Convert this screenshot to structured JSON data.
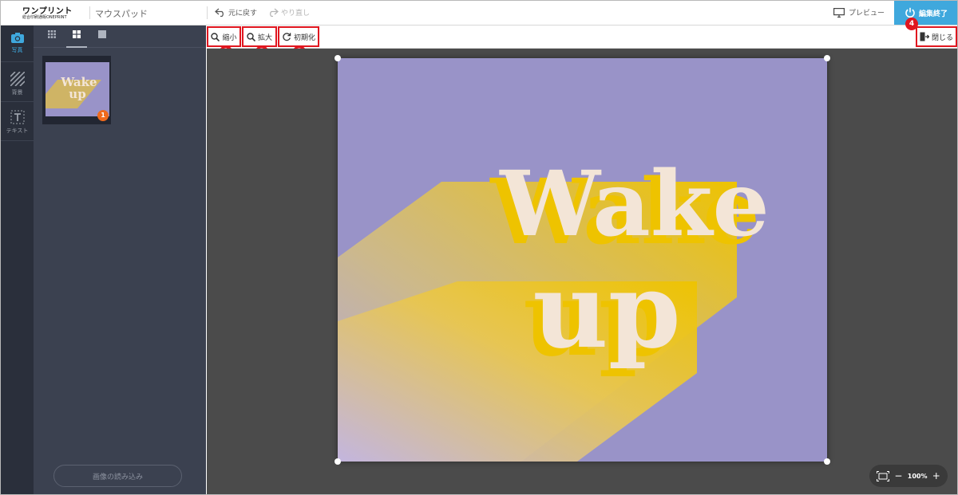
{
  "header": {
    "logo_main": "ワンプリント",
    "logo_sub": "総合印刷通販ONEPRINT",
    "product": "マウスパッド",
    "undo_label": "元に戻す",
    "redo_label": "やり直し",
    "preview_label": "プレビュー",
    "finish_label": "編集終了",
    "finish_number": "4"
  },
  "sidebar": {
    "items": [
      {
        "label": "写真",
        "icon": "camera-icon",
        "active": true
      },
      {
        "label": "背景",
        "icon": "hatch-icon",
        "active": false
      },
      {
        "label": "テキスト",
        "icon": "text-icon",
        "active": false
      }
    ],
    "settings_icon": "gear-icon"
  },
  "panel": {
    "view_tabs": [
      "grid-small-icon",
      "grid-large-icon",
      "single-icon"
    ],
    "thumbnail": {
      "text_line1": "Wake",
      "text_line2": "up",
      "badge": "1"
    },
    "load_button": "画像の読み込み"
  },
  "toolbar": {
    "zoom_out_label": "縮小",
    "zoom_out_number": "1",
    "zoom_in_label": "拡大",
    "zoom_in_number": "2",
    "reset_label": "初期化",
    "reset_number": "3",
    "close_label": "閉じる"
  },
  "canvas": {
    "artwork_line1": "Wake",
    "artwork_line2": "up",
    "zoom_level": "100%"
  },
  "colors": {
    "accent": "#3fa8dd",
    "marker_red": "#e0161f",
    "badge_orange": "#f06a1c",
    "art_bg": "#9993c8",
    "art_shadow": "#eec300",
    "art_text": "#f3e5d7"
  }
}
